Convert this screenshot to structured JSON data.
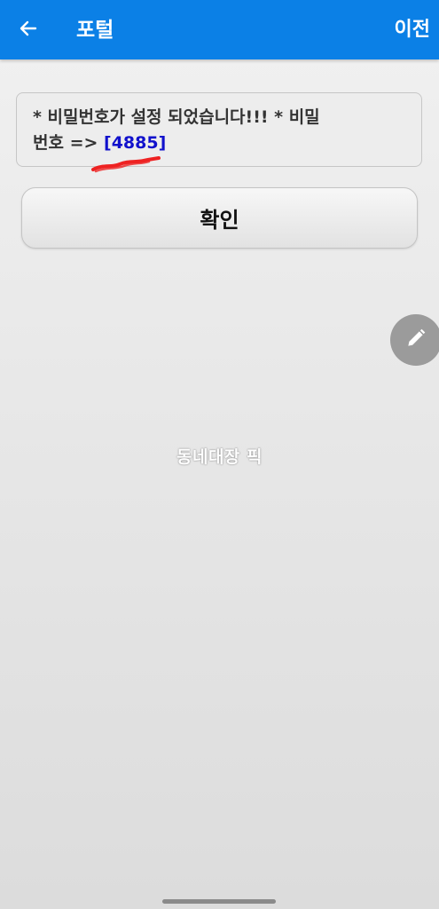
{
  "appbar": {
    "title": "포털",
    "prev_label": "이전",
    "back_icon": "arrow-left-icon",
    "background_color": "#0b80e6"
  },
  "message": {
    "line1": "* 비밀번호가 설정 되었습니다!!! *  비밀",
    "line2_prefix": "번호 => ",
    "password": "[4885]",
    "password_color": "#1111cc"
  },
  "confirm_button": {
    "label": "확인"
  },
  "fab": {
    "icon": "pencil-icon"
  },
  "watermark": {
    "text": "동네대장 픽"
  }
}
